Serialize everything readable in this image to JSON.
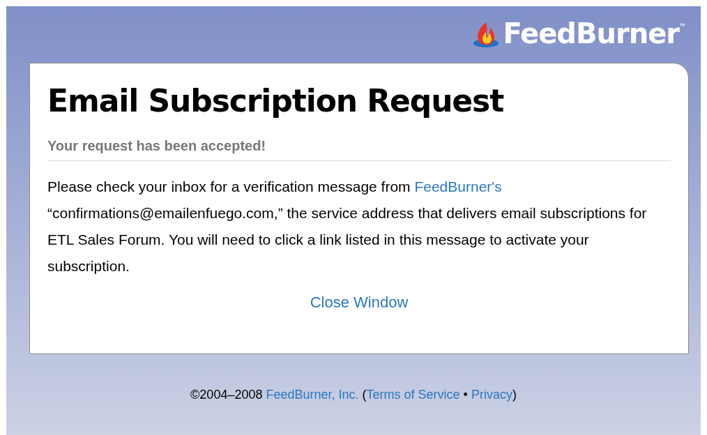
{
  "header": {
    "logo": "FeedBurner",
    "trademark": "™"
  },
  "card": {
    "title": "Email Subscription Request",
    "status": "Your request has been accepted!",
    "message": {
      "before": "Please check your inbox for a verification message from ",
      "link": "FeedBurner's",
      "after": " “confirmations@emailenfuego.com,” the service address that delivers email subscriptions for ETL Sales Forum. You will need to click a link listed in this message to activate your subscription."
    },
    "close_link": "Close Window"
  },
  "footer": {
    "copyright": "©2004–2008",
    "company_link": "FeedBurner, Inc.",
    "open_paren": "(",
    "terms_link": "Terms of Service",
    "separator": "•",
    "privacy_link": "Privacy",
    "close_paren": ")"
  }
}
